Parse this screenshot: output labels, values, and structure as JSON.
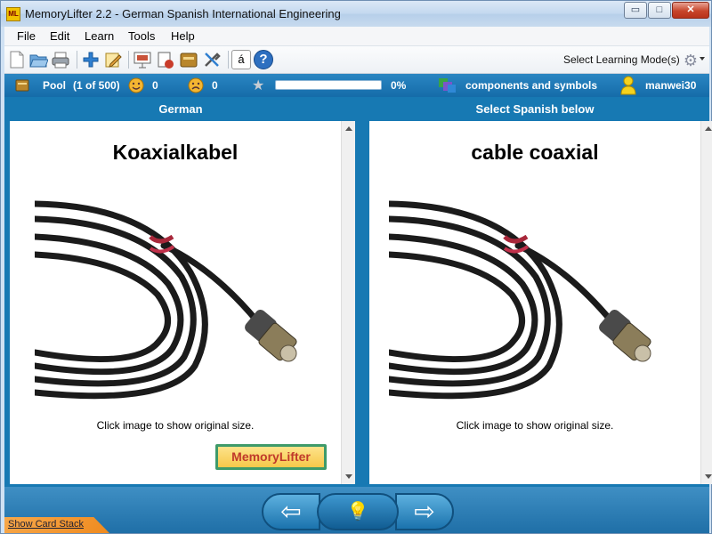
{
  "window": {
    "title": "MemoryLifter 2.2 - German Spanish International Engineering",
    "app_icon_text": "ML",
    "controls": {
      "minimize": "▭",
      "maximize": "□",
      "close": "✕"
    }
  },
  "menu": [
    "File",
    "Edit",
    "Learn",
    "Tools",
    "Help"
  ],
  "toolbar": {
    "icons": [
      "new-file-icon",
      "open-folder-icon",
      "print-icon",
      "add-icon",
      "edit-card-icon",
      "slideshow-icon",
      "settings-card-icon",
      "card-box-icon",
      "tools-icon",
      "special-char-icon",
      "help-icon"
    ],
    "special_char": "á",
    "help_glyph": "?",
    "learning_mode_label": "Select Learning Mode(s)"
  },
  "status": {
    "pool_label": "Pool",
    "pool_count": "(1 of 500)",
    "correct_count": "0",
    "wrong_count": "0",
    "progress_percent_text": "0%",
    "progress_fraction": 0,
    "chapter": "components and symbols",
    "user": "manwei30"
  },
  "left_pane": {
    "header": "German",
    "word": "Koaxialkabel",
    "hint": "Click image to show original size.",
    "logo_text_1": "Memory",
    "logo_text_2": "Lifter"
  },
  "right_pane": {
    "header": "Select Spanish below",
    "word": "cable coaxial",
    "hint": "Click image to show original size."
  },
  "bottom": {
    "prev_glyph": "⇦",
    "hint_glyph": "💡",
    "next_glyph": "⇨",
    "show_card_stack": "Show Card Stack"
  },
  "colors": {
    "accent": "#1779b3",
    "close_button": "#c7452b",
    "stack_tab": "#ef8a1e"
  }
}
